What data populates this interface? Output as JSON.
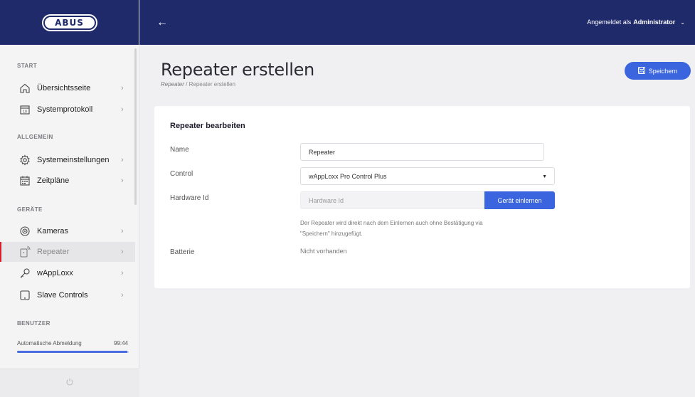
{
  "brand": {
    "logo_text": "ABUS"
  },
  "topbar": {
    "back_label": "←",
    "user_prefix": "Angemeldet als",
    "user_name": "Administrator"
  },
  "sidebar": {
    "sections": [
      {
        "title": "START"
      },
      {
        "title": "ALLGEMEIN"
      },
      {
        "title": "GERÄTE"
      },
      {
        "title": "BENUTZER"
      }
    ],
    "items": [
      {
        "label": "Übersichtsseite",
        "icon": "home-icon"
      },
      {
        "label": "Systemprotokoll",
        "icon": "calendar-icon"
      },
      {
        "label": "Systemeinstellungen",
        "icon": "gear-icon"
      },
      {
        "label": "Zeitpläne",
        "icon": "schedule-icon"
      },
      {
        "label": "Kameras",
        "icon": "camera-icon"
      },
      {
        "label": "Repeater",
        "icon": "repeater-icon",
        "active": true
      },
      {
        "label": "wAppLoxx",
        "icon": "key-icon"
      },
      {
        "label": "Slave Controls",
        "icon": "tablet-icon"
      }
    ],
    "logout": {
      "label": "Automatische Abmeldung",
      "time": "99:44",
      "progress": 0.99
    }
  },
  "page": {
    "title": "Repeater erstellen",
    "breadcrumb_link": "Repeater",
    "breadcrumb_sep": "/",
    "breadcrumb_current": "Repeater erstellen",
    "save_label": "Speichern"
  },
  "form": {
    "card_title": "Repeater bearbeiten",
    "name_label": "Name",
    "name_value": "Repeater",
    "control_label": "Control",
    "control_value": "wAppLoxx Pro Control Plus",
    "hardware_label": "Hardware Id",
    "hardware_placeholder": "Hardware Id",
    "learn_button": "Gerät einlernen",
    "hint_line1": "Der Repeater wird direkt nach dem Einlernen auch ohne Bestätigung via",
    "hint_line2": "\"Speichern\" hinzugefügt.",
    "battery_label": "Batterie",
    "battery_value": "Nicht vorhanden"
  },
  "colors": {
    "header_bg": "#1f2a6b",
    "accent": "#3a65de",
    "active_marker": "#d41f28"
  }
}
